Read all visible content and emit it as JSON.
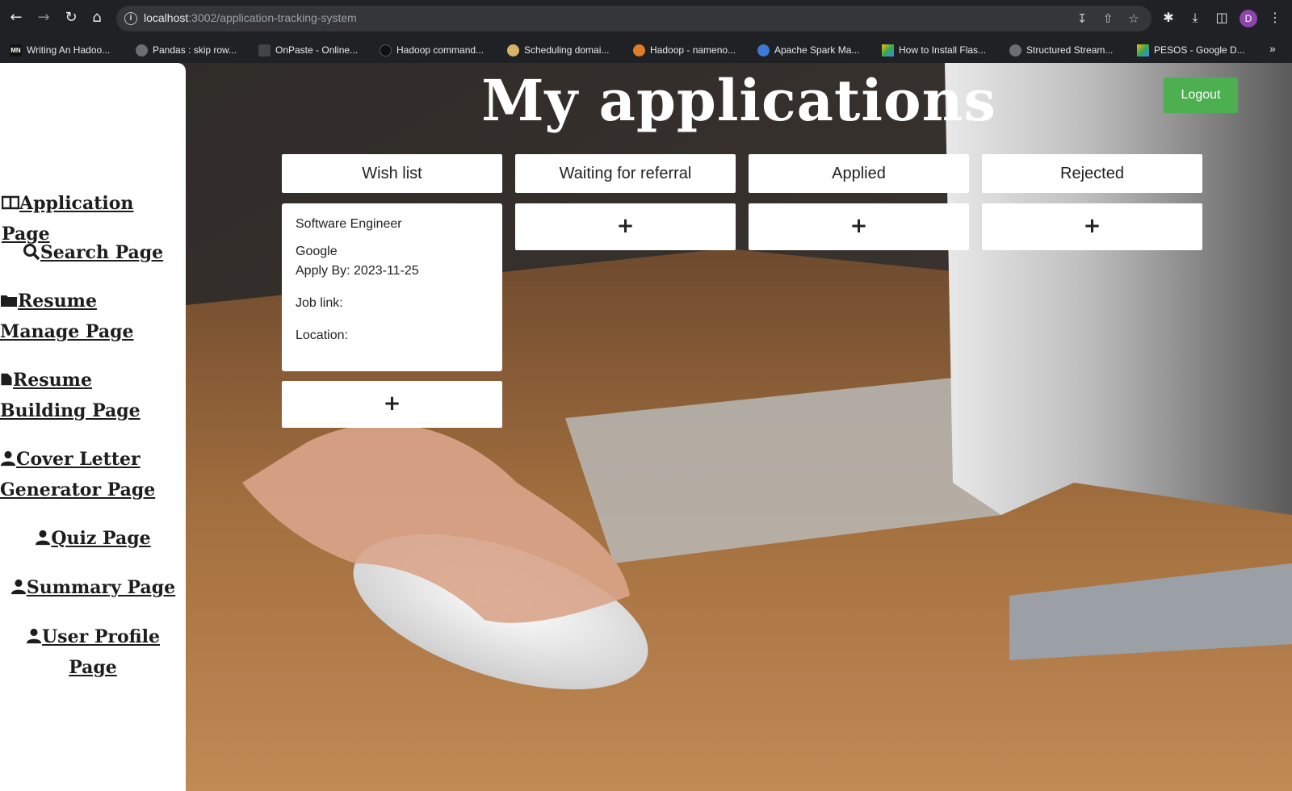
{
  "browser": {
    "url_host": "localhost",
    "url_path": ":3002/application-tracking-system",
    "profile_initial": "D",
    "bookmarks": [
      {
        "label": "Writing An Hadoo...",
        "icon": "MN"
      },
      {
        "label": "Pandas : skip row..."
      },
      {
        "label": "OnPaste - Online..."
      },
      {
        "label": "Hadoop command..."
      },
      {
        "label": "Scheduling domai..."
      },
      {
        "label": "Hadoop - nameno..."
      },
      {
        "label": "Apache Spark Ma..."
      },
      {
        "label": "How to Install Flas..."
      },
      {
        "label": "Structured Stream..."
      },
      {
        "label": "PESOS - Google D..."
      }
    ],
    "more": "»"
  },
  "sidebar": {
    "items": [
      {
        "label": "Application Page",
        "icon": "table-icon"
      },
      {
        "label": "Search Page",
        "icon": "search-icon"
      },
      {
        "label": "Resume Manage Page",
        "icon": "folder-icon"
      },
      {
        "label": "Resume Building Page",
        "icon": "file-icon"
      },
      {
        "label": "Cover Letter Generator Page",
        "icon": "user-icon"
      },
      {
        "label": "Quiz Page",
        "icon": "user-icon"
      },
      {
        "label": "Summary Page",
        "icon": "user-icon"
      },
      {
        "label": "User Profile Page",
        "icon": "user-icon"
      }
    ]
  },
  "header": {
    "title": "My applications",
    "logout_label": "Logout",
    "logout_color": "#4caf50"
  },
  "board": {
    "columns": [
      {
        "title": "Wish list"
      },
      {
        "title": "Waiting for referral"
      },
      {
        "title": "Applied"
      },
      {
        "title": "Rejected"
      }
    ],
    "add_label": "+",
    "card": {
      "job_title": "Software Engineer",
      "company": "Google",
      "apply_by": "Apply By: 2023-11-25",
      "job_link": "Job link:",
      "location": "Location:"
    }
  }
}
